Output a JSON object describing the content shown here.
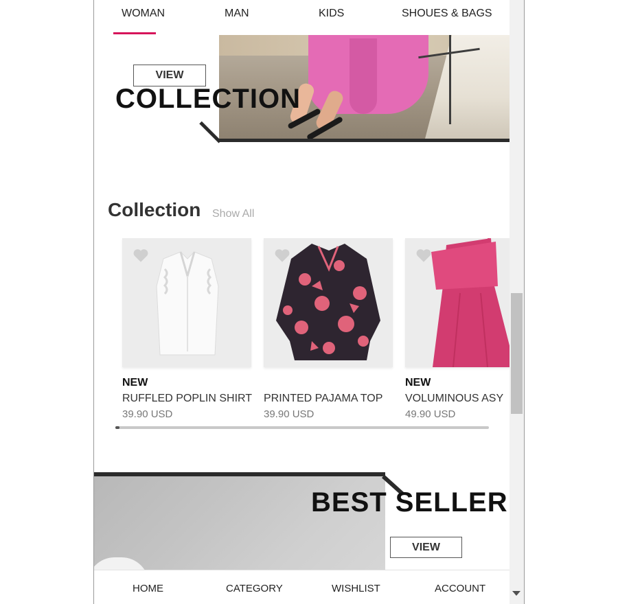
{
  "tabs": [
    {
      "label": "WOMAN",
      "active": true
    },
    {
      "label": "MAN",
      "active": false
    },
    {
      "label": "KIDS",
      "active": false
    },
    {
      "label": "SHOUES & BAGS",
      "active": false
    }
  ],
  "colors": {
    "accent": "#d6145a",
    "dark_bar": "#2b2b2b",
    "card_bg": "#ececec"
  },
  "hero": {
    "view_label": "VIEW",
    "title": "COLLECTION"
  },
  "collection": {
    "title": "Collection",
    "show_all": "Show All",
    "products": [
      {
        "badge": "NEW",
        "name": "RUFFLED POPLIN SHIRT",
        "price": "39.90 USD",
        "icon": "heart-icon"
      },
      {
        "badge": "",
        "name": "PRINTED PAJAMA TOP",
        "price": "39.90 USD",
        "icon": "heart-icon"
      },
      {
        "badge": "NEW",
        "name": "VOLUMINOUS ASY",
        "price": "49.90 USD",
        "icon": "heart-icon"
      }
    ]
  },
  "best_seller": {
    "title": "BEST SELLER",
    "view_label": "VIEW"
  },
  "bottom_nav": [
    {
      "label": "HOME"
    },
    {
      "label": "CATEGORY"
    },
    {
      "label": "WISHLIST"
    },
    {
      "label": "ACCOUNT"
    }
  ]
}
